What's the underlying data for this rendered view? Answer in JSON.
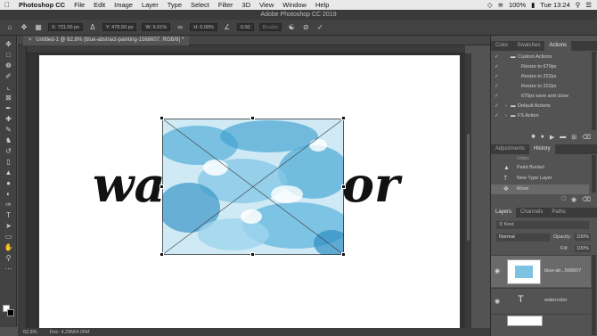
{
  "menubar": {
    "apple": "",
    "items": [
      "Photoshop CC",
      "File",
      "Edit",
      "Image",
      "Layer",
      "Type",
      "Select",
      "Filter",
      "3D",
      "View",
      "Window",
      "Help"
    ],
    "clock": "Tue 13:24",
    "battery": "100%"
  },
  "window": {
    "title": "Adobe Photoshop CC 2019"
  },
  "options": {
    "x": "X: 731.00 px",
    "y": "Y: 476.50 px",
    "w": "W: 6.01%",
    "h": "H: 6.00%",
    "angle": "0.00",
    "interp": "Bicubic",
    "cancel_icon": "cancel-icon",
    "commit_icon": "check-icon"
  },
  "document": {
    "tab_label": "Untitled-1 @ 62.8% (blue-abstract-painting-1568607, RGB/8) *",
    "word_left": "wa",
    "word_right": "or",
    "zoom": "62.8%",
    "doc_size": "Doc: 4.29M/4.00M"
  },
  "panels": {
    "actions_tabs": [
      "Color",
      "Swatches",
      "Actions"
    ],
    "actions": [
      {
        "label": "Custom Actions"
      },
      {
        "label": "Resize to 670px"
      },
      {
        "label": "Resize to 222px"
      },
      {
        "label": "Resize to 222px"
      },
      {
        "label": "670px save and close"
      },
      {
        "label": "Default Actions"
      },
      {
        "label": "FS Action"
      }
    ],
    "history_tabs": [
      "Adjustments",
      "History"
    ],
    "history": [
      {
        "label": "Video"
      },
      {
        "label": "Paint Bucket"
      },
      {
        "label": "New Type Layer"
      },
      {
        "label": "Move"
      }
    ],
    "layers_tabs": [
      "Layers",
      "Channels",
      "Paths"
    ],
    "kind": "Kind",
    "blend": "Normal",
    "opacity_label": "Opacity:",
    "opacity": "100%",
    "fill_label": "Fill:",
    "fill": "100%",
    "layers": [
      {
        "name": "blue-ab...568607",
        "kind": "image"
      },
      {
        "name": "watercolor",
        "kind": "type"
      },
      {
        "name": "",
        "kind": "fill"
      }
    ]
  },
  "colors": {
    "accent": "#4a9fd8",
    "panel": "#535353",
    "canvas": "#ffffff"
  }
}
